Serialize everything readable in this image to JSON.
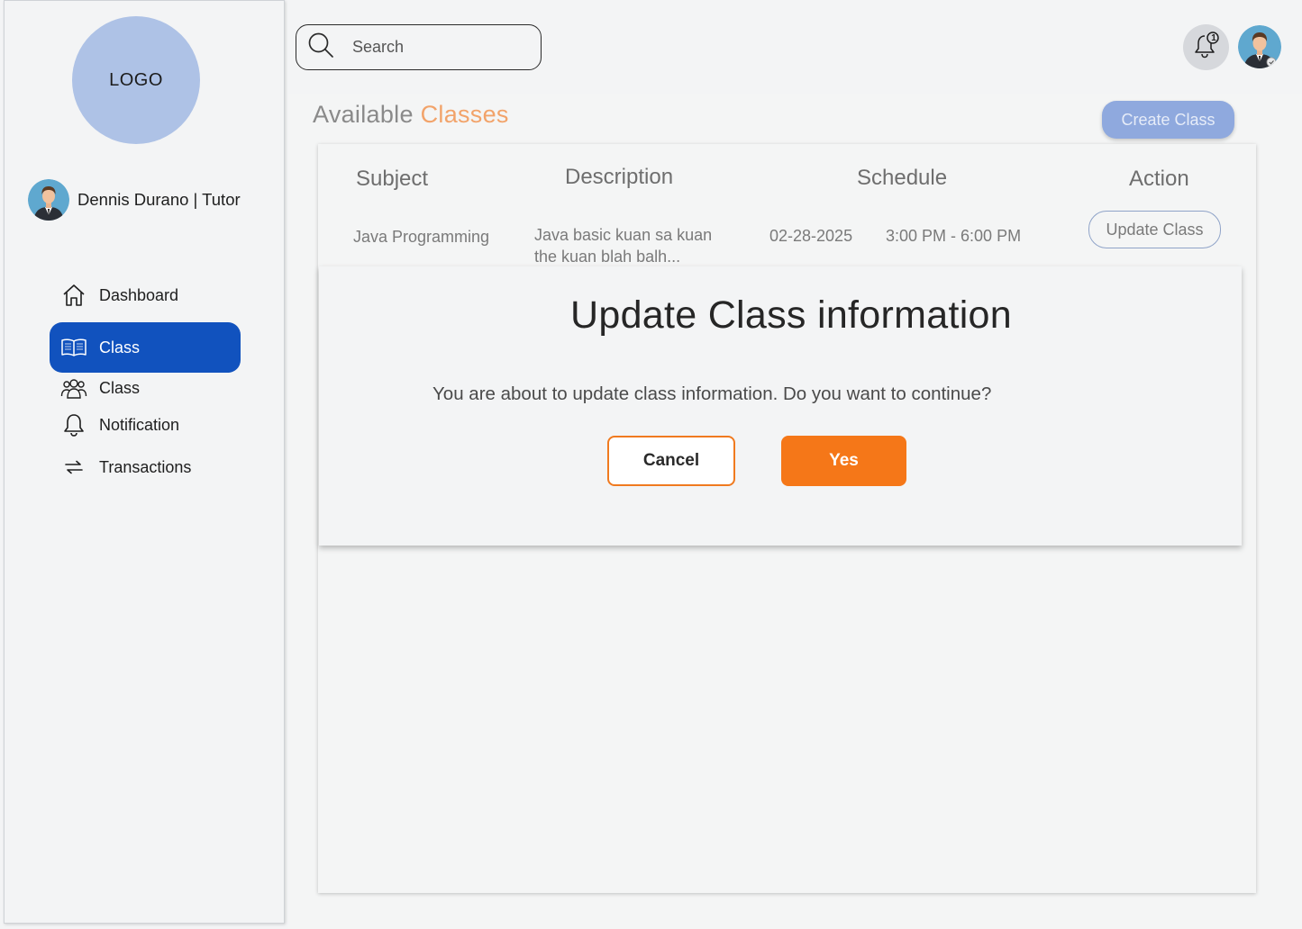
{
  "sidebar": {
    "logo_text": "LOGO",
    "user_name": "Dennis Durano | Tutor",
    "items": [
      {
        "label": "Dashboard",
        "icon": "home-icon"
      },
      {
        "label": "Class",
        "icon": "book-icon",
        "active": true
      },
      {
        "label": "Class",
        "icon": "users-icon"
      },
      {
        "label": "Notification",
        "icon": "bell-icon"
      },
      {
        "label": "Transactions",
        "icon": "transfer-icon"
      }
    ]
  },
  "header": {
    "search_placeholder": "Search",
    "notification_count": "1"
  },
  "main": {
    "title_prefix": "Available",
    "title_accent": "Classes",
    "create_label": "Create Class",
    "columns": [
      "Subject",
      "Description",
      "Schedule",
      "Action"
    ],
    "rows": [
      {
        "subject": "Java Programming",
        "description_line1": "Java basic kuan sa kuan",
        "description_line2": "the kuan blah balh...",
        "date": "02-28-2025",
        "time": "3:00 PM - 6:00 PM",
        "action_label": "Update Class"
      }
    ]
  },
  "modal": {
    "title": "Update Class information",
    "message": "You are about to update class information. Do you want to continue?",
    "cancel_label": "Cancel",
    "confirm_label": "Yes"
  },
  "colors": {
    "primary": "#1152be",
    "accent_orange": "#f57718",
    "title_accent": "#f2a36a",
    "create_button": "#8fa9de"
  }
}
